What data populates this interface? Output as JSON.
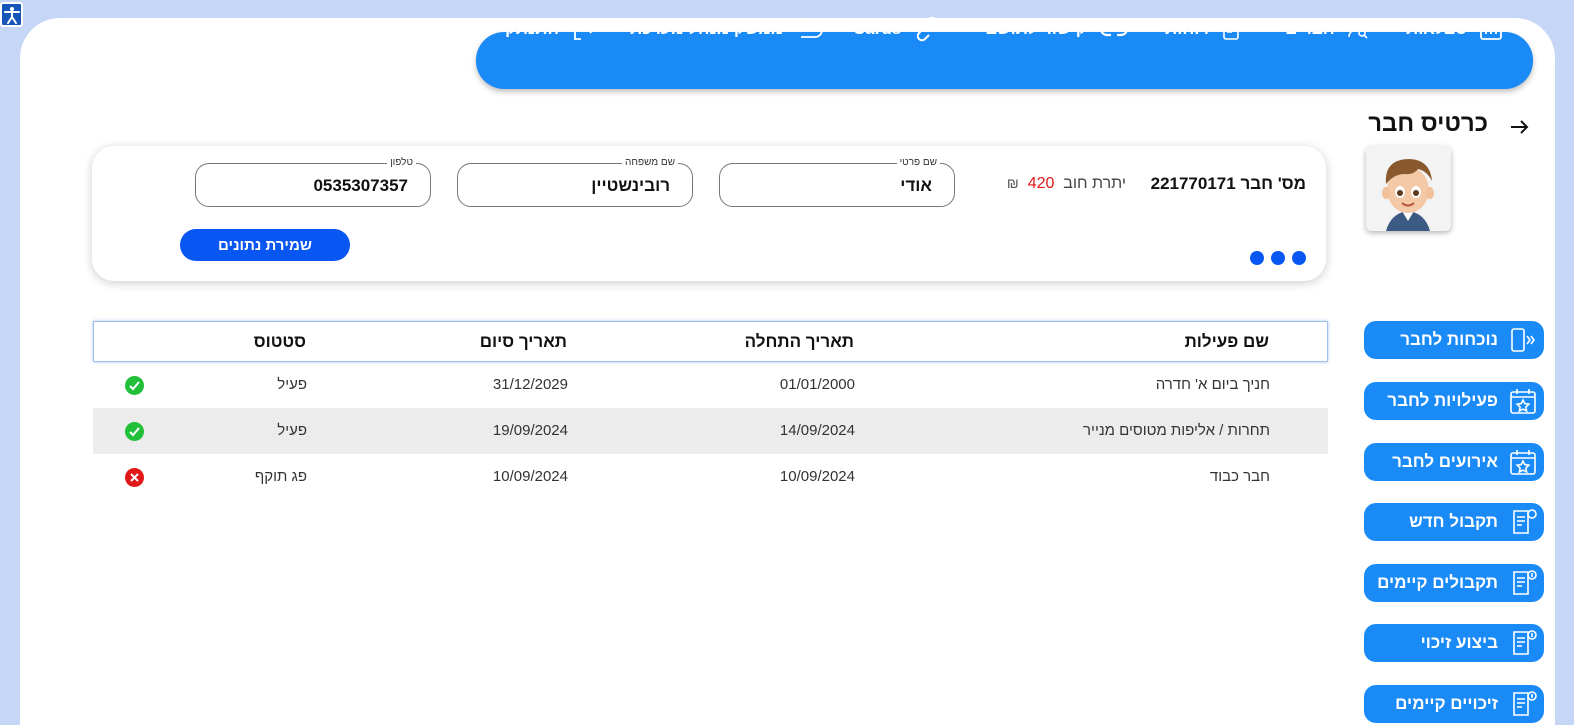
{
  "accessibility": {
    "icon": "accessibility-icon"
  },
  "nav": {
    "items": [
      {
        "label": "טבלאות",
        "icon": "bar-chart-icon"
      },
      {
        "label": "חברים",
        "icon": "user-search-icon"
      },
      {
        "label": "דוחות",
        "icon": "report-icon"
      },
      {
        "label": "קישור לתושב",
        "icon": "link-icon"
      },
      {
        "label": "Cards",
        "icon": "chain-link-icon"
      },
      {
        "label": "ממשק מנהל מערכת",
        "icon": "return-arrow-icon"
      },
      {
        "label": "התנתק",
        "icon": "logout-icon"
      }
    ]
  },
  "page": {
    "title": "כרטיס חבר",
    "back_icon": "arrow-right-icon"
  },
  "member": {
    "number_label": "מס' חבר",
    "number": "221770171",
    "debt_label": "יתרת חוב",
    "debt_amount": "420",
    "currency": "₪",
    "first_name_label": "שם פרטי",
    "first_name": "אודי",
    "last_name_label": "שם משפחה",
    "last_name": "רובינשטיין",
    "phone_label": "טלפון",
    "phone": "0535307357",
    "save_label": "שמירת נתונים"
  },
  "table": {
    "headers": {
      "name": "שם פעילות",
      "start": "תאריך התחלה",
      "end": "תאריך סיום",
      "status": "סטטוס"
    },
    "rows": [
      {
        "name": "חניך ביום א' חדרה",
        "start": "01/01/2000",
        "end": "31/12/2029",
        "status": "פעיל",
        "ok": true
      },
      {
        "name": "תחרות / אליפות מטוסים מנייר",
        "start": "14/09/2024",
        "end": "19/09/2024",
        "status": "פעיל",
        "ok": true
      },
      {
        "name": "חבר כבוד",
        "start": "10/09/2024",
        "end": "10/09/2024",
        "status": "פג תוקף",
        "ok": false
      }
    ]
  },
  "side": {
    "buttons": [
      {
        "label": "נוכחות לחבר",
        "icon": "door-entry-icon"
      },
      {
        "label": "פעילויות לחבר",
        "icon": "calendar-star-icon"
      },
      {
        "label": "אירועים לחבר",
        "icon": "calendar-star-icon"
      },
      {
        "label": "תקבול חדש",
        "icon": "receipt-new-icon"
      },
      {
        "label": "תקבולים קיימים",
        "icon": "receipt-coin-icon"
      },
      {
        "label": "ביצוע זיכוי",
        "icon": "receipt-coin-icon"
      },
      {
        "label": "זיכויים קיימים",
        "icon": "receipt-coin-icon"
      }
    ]
  },
  "colors": {
    "accent": "#1a8af7",
    "primary_dark": "#0957f3",
    "danger": "#e01818",
    "success": "#22c03a"
  }
}
